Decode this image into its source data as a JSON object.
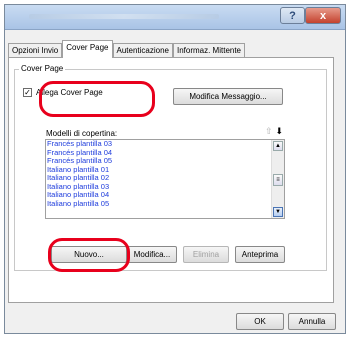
{
  "tabs": [
    {
      "label": "Opzioni Invio",
      "active": false
    },
    {
      "label": "Cover Page",
      "active": true
    },
    {
      "label": "Autenticazione",
      "active": false
    },
    {
      "label": "Informaz. Mittente",
      "active": false
    }
  ],
  "titlebar": {
    "help": "?",
    "close": "x"
  },
  "group": {
    "label": "Cover Page",
    "attach_checkbox": {
      "label": "Allega Cover Page",
      "checked": true,
      "mark": "✓"
    },
    "edit_message_button": "Modifica Messaggio...",
    "list_label": "Modelli di copertina:",
    "move_up": "⇧",
    "move_down": "⬇",
    "templates": [
      "Francés plantilla 03",
      "Francés plantilla 04",
      "Francés plantilla 05",
      "Italiano plantilla 01",
      "Italiano plantilla 02",
      "Italiano plantilla 03",
      "Italiano plantilla 04",
      "Italiano plantilla 05"
    ],
    "buttons": {
      "new": "Nuovo...",
      "modify": "Modifica...",
      "delete": "Elimina",
      "preview": "Anteprima"
    }
  },
  "footer": {
    "ok": "OK",
    "cancel": "Annulla"
  },
  "highlight_color": "#e8001c"
}
